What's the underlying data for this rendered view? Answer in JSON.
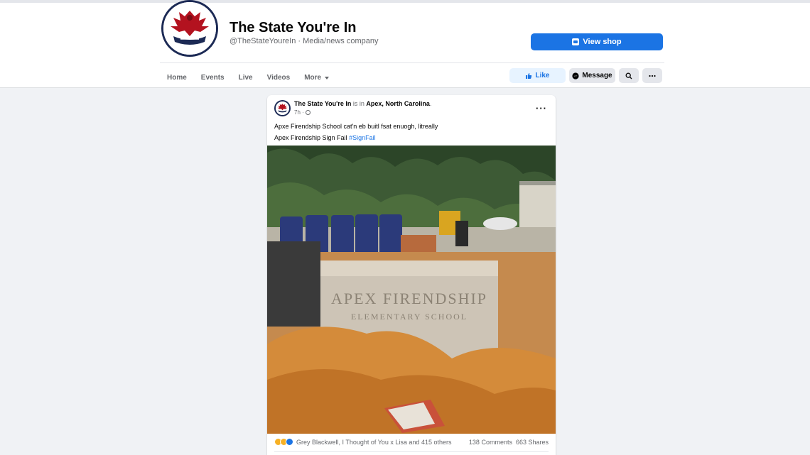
{
  "page": {
    "name": "The State You're In",
    "subtitle": "@TheStateYoureIn · Media/news company",
    "view_shop_label": "View shop"
  },
  "tabs": [
    {
      "label": "Home"
    },
    {
      "label": "Events"
    },
    {
      "label": "Live"
    },
    {
      "label": "Videos"
    },
    {
      "label": "More"
    }
  ],
  "actions": {
    "like_label": "Like",
    "message_label": "Message"
  },
  "post": {
    "author": "The State You're In",
    "is_in": "is in",
    "location": "Apex, North Carolina",
    "time": "7h ·",
    "line1": "Apxe Firendship School cat'n eb buitl fsat enuogh, litreally",
    "line2": "Apex Firendship Sign Fail",
    "hashtag": "#SignFail",
    "sign_line1": "APEX FIRENDSHIP",
    "sign_line2": "ELEMENTARY SCHOOL",
    "reactors": "Grey Blackwell, I Thought of You x Lisa and 415 others",
    "comments": "138 Comments",
    "shares": "663 Shares"
  },
  "colors": {
    "brand_blue": "#1b74e4",
    "logo_navy": "#1c2a55",
    "logo_red": "#b3121f"
  },
  "icons": [
    "shop-icon",
    "like-icon",
    "messenger-icon",
    "search-icon",
    "more-icon",
    "globe-icon",
    "haha-icon",
    "wow-icon",
    "like-reaction-icon"
  ]
}
